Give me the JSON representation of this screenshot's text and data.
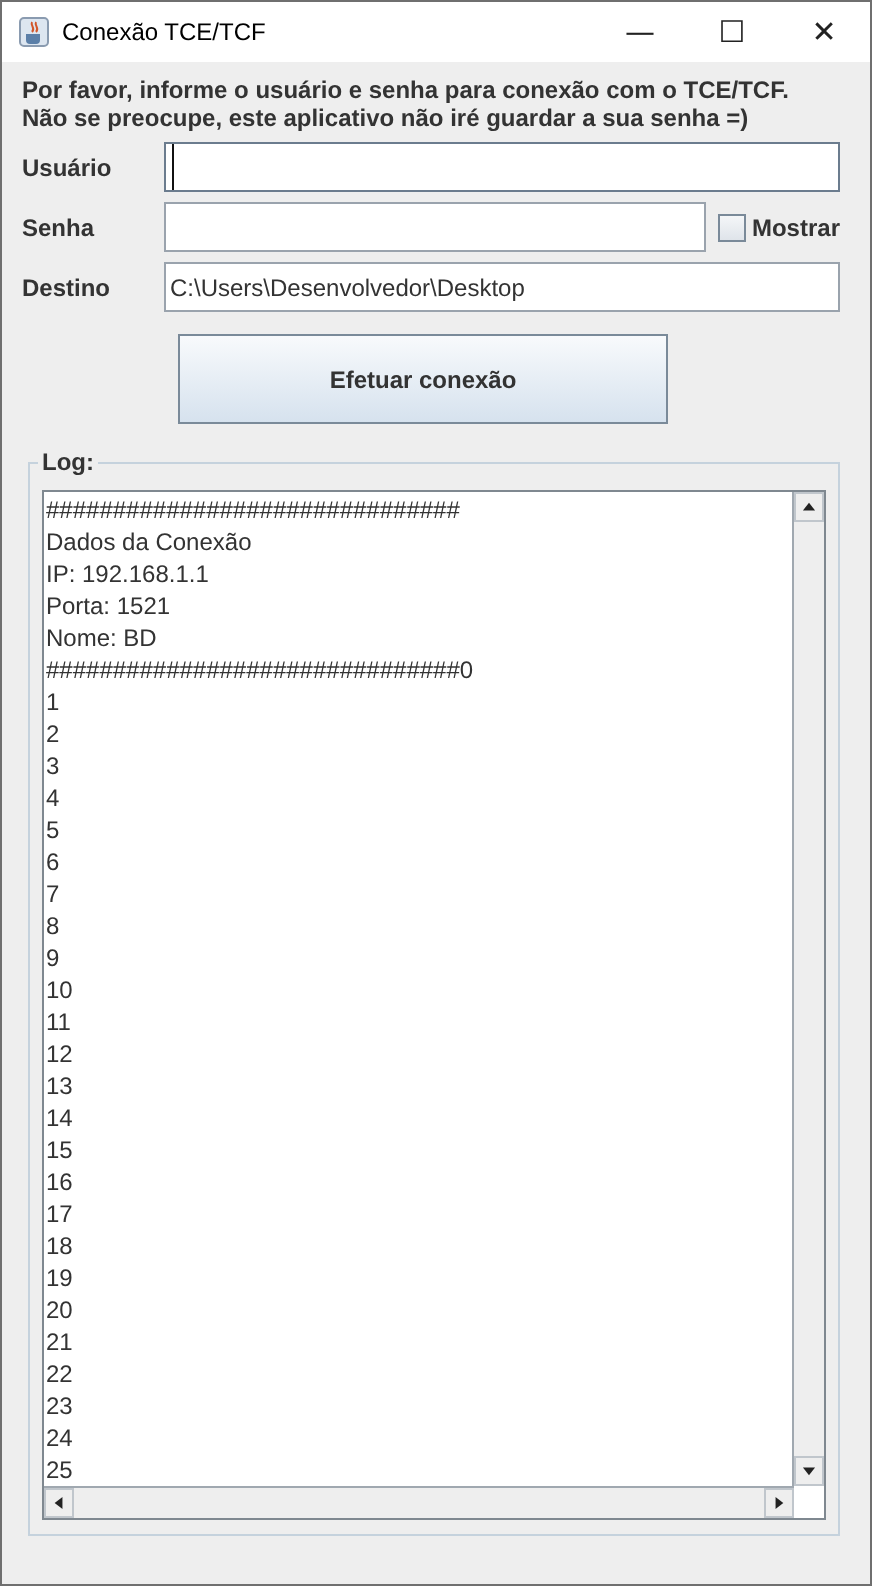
{
  "window": {
    "title": "Conexão TCE/TCF",
    "controls": [
      "—",
      "☐",
      "✕"
    ]
  },
  "instructions": [
    "Por favor, informe o usuário e senha para conexão com o TCE/TCF.",
    "Não se preocupe, este aplicativo não iré guardar a sua senha =)"
  ],
  "fields": [
    {
      "label": "Usuário",
      "kind": "text",
      "focused": true
    },
    {
      "label": "Senha",
      "kind": "password",
      "focused": false,
      "show_checkbox": {
        "label": "Mostrar",
        "checked": false
      }
    },
    {
      "label": "Destino",
      "kind": "text",
      "value": "C:\\Users\\Desenvolvedor\\Desktop",
      "focused": false
    }
  ],
  "connect_button": "Efetuar conexão",
  "log": {
    "label": "Log:",
    "lines": [
      "###############################",
      "Dados da Conexão",
      "IP: 192.168.1.1",
      "Porta: 1521",
      "Nome: BD",
      "###############################0",
      "1",
      "2",
      "3",
      "4",
      "5",
      "6",
      "7",
      "8",
      "9",
      "10",
      "11",
      "12",
      "13",
      "14",
      "15",
      "16",
      "17",
      "18",
      "19",
      "20",
      "21",
      "22",
      "23",
      "24",
      "25"
    ]
  }
}
